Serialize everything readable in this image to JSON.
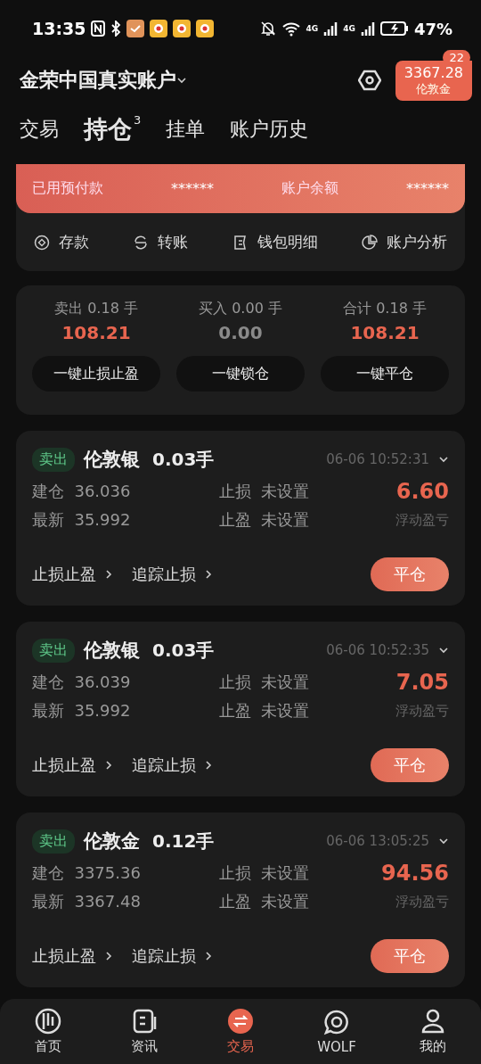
{
  "status_bar": {
    "time": "13:35",
    "network_1": "4G",
    "network_2": "4G",
    "battery": "47%"
  },
  "header": {
    "account": "金荣中国真实账户",
    "notification_count": "22",
    "price_chip": {
      "price": "3367.28",
      "symbol": "伦敦金"
    }
  },
  "tabs": [
    {
      "label": "交易",
      "selected": false
    },
    {
      "label": "持仓",
      "selected": true,
      "count": "3"
    },
    {
      "label": "挂单",
      "selected": false
    },
    {
      "label": "账户历史",
      "selected": false
    }
  ],
  "balance": [
    {
      "label": "已用预付款",
      "value": "******"
    },
    {
      "label": "账户余额",
      "value": "******"
    }
  ],
  "actions": [
    "存款",
    "转账",
    "钱包明细",
    "账户分析"
  ],
  "summary": {
    "columns": [
      {
        "label": "卖出",
        "lots": "0.18",
        "unit": "手",
        "amount": "108.21",
        "color": "#e8654f"
      },
      {
        "label": "买入",
        "lots": "0.00",
        "unit": "手",
        "amount": "0.00",
        "color": "#8a8a8a"
      },
      {
        "label": "合计",
        "lots": "0.18",
        "unit": "手",
        "amount": "108.21",
        "color": "#e8654f"
      }
    ],
    "buttons": [
      "一键止损止盈",
      "一键锁仓",
      "一键平仓"
    ]
  },
  "positions": [
    {
      "side": "卖出",
      "symbol": "伦敦银",
      "lots": "0.03手",
      "time": "06-06 10:52:31",
      "open_label": "建仓",
      "open": "36.036",
      "latest_label": "最新",
      "latest": "35.992",
      "sl_label": "止损",
      "sl": "未设置",
      "tp_label": "止盈",
      "tp": "未设置",
      "pnl": "6.60",
      "pnl_label": "浮动盈亏",
      "links": [
        "止损止盈",
        "追踪止损"
      ],
      "close": "平仓"
    },
    {
      "side": "卖出",
      "symbol": "伦敦银",
      "lots": "0.03手",
      "time": "06-06 10:52:35",
      "open_label": "建仓",
      "open": "36.039",
      "latest_label": "最新",
      "latest": "35.992",
      "sl_label": "止损",
      "sl": "未设置",
      "tp_label": "止盈",
      "tp": "未设置",
      "pnl": "7.05",
      "pnl_label": "浮动盈亏",
      "links": [
        "止损止盈",
        "追踪止损"
      ],
      "close": "平仓"
    },
    {
      "side": "卖出",
      "symbol": "伦敦金",
      "lots": "0.12手",
      "time": "06-06 13:05:25",
      "open_label": "建仓",
      "open": "3375.36",
      "latest_label": "最新",
      "latest": "3367.48",
      "sl_label": "止损",
      "sl": "未设置",
      "tp_label": "止盈",
      "tp": "未设置",
      "pnl": "94.56",
      "pnl_label": "浮动盈亏",
      "links": [
        "止损止盈",
        "追踪止损"
      ],
      "close": "平仓"
    }
  ],
  "nav": [
    {
      "label": "首页",
      "selected": false
    },
    {
      "label": "资讯",
      "selected": false
    },
    {
      "label": "交易",
      "selected": true
    },
    {
      "label": "WOLF",
      "selected": false
    },
    {
      "label": "我的",
      "selected": false
    }
  ]
}
